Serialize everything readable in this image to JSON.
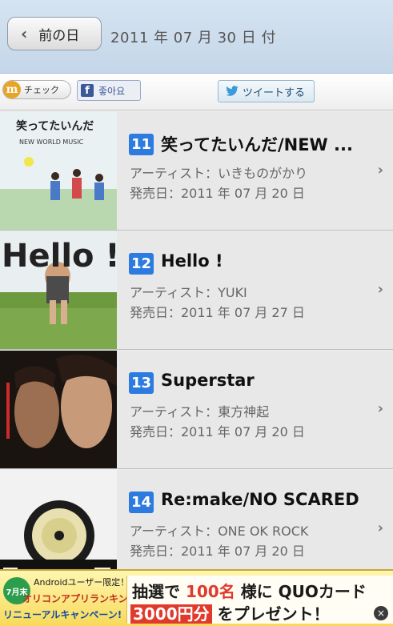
{
  "header": {
    "prev_label": "前の日",
    "date_label": "2011 年 07 月 30 日 付"
  },
  "social": {
    "mixi_label": "チェック",
    "mixi_logo": "m",
    "facebook_label": "좋아요",
    "facebook_logo": "f",
    "tweet_label": "ツイートする"
  },
  "list": {
    "items": [
      {
        "rank": "11",
        "title": "笑ってたいんだ/NEW ...",
        "artist": "アーティスト：いきものがかり",
        "release": "発売日：2011 年 07 月 20 日",
        "jacket": {
          "top_text": "笑ってたいんだ",
          "sub_text": "NEW WORLD MUSIC"
        }
      },
      {
        "rank": "12",
        "title": "Hello !",
        "artist": "アーティスト：YUKI",
        "release": "発売日：2011 年 07 月 27 日",
        "jacket": {
          "top_text": "Hello !"
        }
      },
      {
        "rank": "13",
        "title": "Superstar",
        "artist": "アーティスト：東方神起",
        "release": "発売日：2011 年 07 月 20 日",
        "jacket": {
          "top_text": ""
        }
      },
      {
        "rank": "14",
        "title": "Re:make/NO SCARED",
        "artist": "アーティスト：ONE OK ROCK",
        "release": "発売日：2011 年 07 月 20 日",
        "jacket": {
          "top_text": ""
        }
      }
    ]
  },
  "ad": {
    "badge": "7月末",
    "line1": "Androidユーザー限定！",
    "line2": "オリコンアプリランキング",
    "line3": "リニューアルキャンペーン!",
    "r1_pre": "抽選で",
    "r1_count": "100名",
    "r1_post": "様に QUOカード",
    "r2_amount": "3000円分",
    "r2_post": "をプレゼント！",
    "close": "×"
  },
  "colors": {
    "header_bg": "#c9dbec",
    "rank_badge": "#2d7be0",
    "facebook": "#3b5998",
    "ad_accent": "#e03a2c"
  }
}
